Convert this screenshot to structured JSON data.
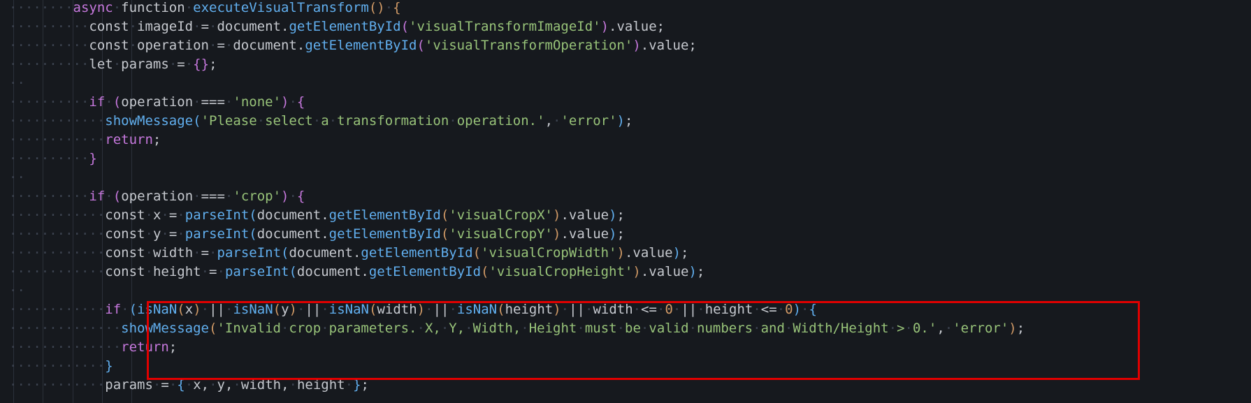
{
  "editor": {
    "theme_colors": {
      "background": "#16191e",
      "keyword": "#c678dd",
      "function": "#61afef",
      "string": "#98c379",
      "number": "#d19a66",
      "text": "#c6c9cf",
      "whitespace_marker": "#3c4350",
      "highlight_border": "#e00000"
    },
    "lines": [
      {
        "indent": 6,
        "tokens": [
          [
            "kw",
            "async"
          ],
          [
            "ws",
            "·"
          ],
          [
            "txt",
            "function"
          ],
          [
            "ws",
            "·"
          ],
          [
            "fn",
            "executeVisualTransform"
          ],
          [
            "br1",
            "()"
          ],
          [
            "ws",
            "·"
          ],
          [
            "br1",
            "{"
          ]
        ]
      },
      {
        "indent": 8,
        "tokens": [
          [
            "txt",
            "const"
          ],
          [
            "ws",
            "·"
          ],
          [
            "txt",
            "imageId"
          ],
          [
            "ws",
            "·"
          ],
          [
            "txt",
            "="
          ],
          [
            "ws",
            "·"
          ],
          [
            "txt",
            "document."
          ],
          [
            "fn",
            "getElementById"
          ],
          [
            "br2",
            "("
          ],
          [
            "str",
            "'visualTransformImageId'"
          ],
          [
            "br2",
            ")"
          ],
          [
            "txt",
            ".value;"
          ]
        ]
      },
      {
        "indent": 8,
        "tokens": [
          [
            "txt",
            "const"
          ],
          [
            "ws",
            "·"
          ],
          [
            "txt",
            "operation"
          ],
          [
            "ws",
            "·"
          ],
          [
            "txt",
            "="
          ],
          [
            "ws",
            "·"
          ],
          [
            "txt",
            "document."
          ],
          [
            "fn",
            "getElementById"
          ],
          [
            "br2",
            "("
          ],
          [
            "str",
            "'visualTransformOperation'"
          ],
          [
            "br2",
            ")"
          ],
          [
            "txt",
            ".value;"
          ]
        ]
      },
      {
        "indent": 8,
        "tokens": [
          [
            "txt",
            "let"
          ],
          [
            "ws",
            "·"
          ],
          [
            "txt",
            "params"
          ],
          [
            "ws",
            "·"
          ],
          [
            "txt",
            "="
          ],
          [
            "ws",
            "·"
          ],
          [
            "br2",
            "{}"
          ],
          [
            "txt",
            ";"
          ]
        ]
      },
      {
        "indent": 0,
        "tokens": []
      },
      {
        "indent": 8,
        "tokens": [
          [
            "kw",
            "if"
          ],
          [
            "ws",
            "·"
          ],
          [
            "br2",
            "("
          ],
          [
            "txt",
            "operation"
          ],
          [
            "ws",
            "·"
          ],
          [
            "txt",
            "==="
          ],
          [
            "ws",
            "·"
          ],
          [
            "str",
            "'none'"
          ],
          [
            "br2",
            ")"
          ],
          [
            "ws",
            "·"
          ],
          [
            "br2",
            "{"
          ]
        ]
      },
      {
        "indent": 10,
        "tokens": [
          [
            "fn",
            "showMessage"
          ],
          [
            "br3",
            "("
          ],
          [
            "str",
            "'Please"
          ],
          [
            "ws",
            "·"
          ],
          [
            "str",
            "select"
          ],
          [
            "ws",
            "·"
          ],
          [
            "str",
            "a"
          ],
          [
            "ws",
            "·"
          ],
          [
            "str",
            "transformation"
          ],
          [
            "ws",
            "·"
          ],
          [
            "str",
            "operation.'"
          ],
          [
            "txt",
            ","
          ],
          [
            "ws",
            "·"
          ],
          [
            "str",
            "'error'"
          ],
          [
            "br3",
            ")"
          ],
          [
            "txt",
            ";"
          ]
        ]
      },
      {
        "indent": 10,
        "tokens": [
          [
            "kw",
            "return"
          ],
          [
            "txt",
            ";"
          ]
        ]
      },
      {
        "indent": 8,
        "tokens": [
          [
            "br2",
            "}"
          ]
        ]
      },
      {
        "indent": 0,
        "tokens": []
      },
      {
        "indent": 8,
        "tokens": [
          [
            "kw",
            "if"
          ],
          [
            "ws",
            "·"
          ],
          [
            "br2",
            "("
          ],
          [
            "txt",
            "operation"
          ],
          [
            "ws",
            "·"
          ],
          [
            "txt",
            "==="
          ],
          [
            "ws",
            "·"
          ],
          [
            "str",
            "'crop'"
          ],
          [
            "br2",
            ")"
          ],
          [
            "ws",
            "·"
          ],
          [
            "br2",
            "{"
          ]
        ]
      },
      {
        "indent": 10,
        "tokens": [
          [
            "txt",
            "const"
          ],
          [
            "ws",
            "·"
          ],
          [
            "txt",
            "x"
          ],
          [
            "ws",
            "·"
          ],
          [
            "txt",
            "="
          ],
          [
            "ws",
            "·"
          ],
          [
            "fn",
            "parseInt"
          ],
          [
            "br3",
            "("
          ],
          [
            "txt",
            "document."
          ],
          [
            "fn",
            "getElementById"
          ],
          [
            "br1",
            "("
          ],
          [
            "str",
            "'visualCropX'"
          ],
          [
            "br1",
            ")"
          ],
          [
            "txt",
            ".value"
          ],
          [
            "br3",
            ")"
          ],
          [
            "txt",
            ";"
          ]
        ]
      },
      {
        "indent": 10,
        "tokens": [
          [
            "txt",
            "const"
          ],
          [
            "ws",
            "·"
          ],
          [
            "txt",
            "y"
          ],
          [
            "ws",
            "·"
          ],
          [
            "txt",
            "="
          ],
          [
            "ws",
            "·"
          ],
          [
            "fn",
            "parseInt"
          ],
          [
            "br3",
            "("
          ],
          [
            "txt",
            "document."
          ],
          [
            "fn",
            "getElementById"
          ],
          [
            "br1",
            "("
          ],
          [
            "str",
            "'visualCropY'"
          ],
          [
            "br1",
            ")"
          ],
          [
            "txt",
            ".value"
          ],
          [
            "br3",
            ")"
          ],
          [
            "txt",
            ";"
          ]
        ]
      },
      {
        "indent": 10,
        "tokens": [
          [
            "txt",
            "const"
          ],
          [
            "ws",
            "·"
          ],
          [
            "txt",
            "width"
          ],
          [
            "ws",
            "·"
          ],
          [
            "txt",
            "="
          ],
          [
            "ws",
            "·"
          ],
          [
            "fn",
            "parseInt"
          ],
          [
            "br3",
            "("
          ],
          [
            "txt",
            "document."
          ],
          [
            "fn",
            "getElementById"
          ],
          [
            "br1",
            "("
          ],
          [
            "str",
            "'visualCropWidth'"
          ],
          [
            "br1",
            ")"
          ],
          [
            "txt",
            ".value"
          ],
          [
            "br3",
            ")"
          ],
          [
            "txt",
            ";"
          ]
        ]
      },
      {
        "indent": 10,
        "tokens": [
          [
            "txt",
            "const"
          ],
          [
            "ws",
            "·"
          ],
          [
            "txt",
            "height"
          ],
          [
            "ws",
            "·"
          ],
          [
            "txt",
            "="
          ],
          [
            "ws",
            "·"
          ],
          [
            "fn",
            "parseInt"
          ],
          [
            "br3",
            "("
          ],
          [
            "txt",
            "document."
          ],
          [
            "fn",
            "getElementById"
          ],
          [
            "br1",
            "("
          ],
          [
            "str",
            "'visualCropHeight'"
          ],
          [
            "br1",
            ")"
          ],
          [
            "txt",
            ".value"
          ],
          [
            "br3",
            ")"
          ],
          [
            "txt",
            ";"
          ]
        ]
      },
      {
        "indent": 0,
        "tokens": []
      },
      {
        "indent": 10,
        "tokens": [
          [
            "kw",
            "if"
          ],
          [
            "ws",
            "·"
          ],
          [
            "br3",
            "("
          ],
          [
            "fn",
            "isNaN"
          ],
          [
            "br1",
            "("
          ],
          [
            "txt",
            "x"
          ],
          [
            "br1",
            ")"
          ],
          [
            "ws",
            "·"
          ],
          [
            "txt",
            "||"
          ],
          [
            "ws",
            "·"
          ],
          [
            "fn",
            "isNaN"
          ],
          [
            "br1",
            "("
          ],
          [
            "txt",
            "y"
          ],
          [
            "br1",
            ")"
          ],
          [
            "ws",
            "·"
          ],
          [
            "txt",
            "||"
          ],
          [
            "ws",
            "·"
          ],
          [
            "fn",
            "isNaN"
          ],
          [
            "br1",
            "("
          ],
          [
            "txt",
            "width"
          ],
          [
            "br1",
            ")"
          ],
          [
            "ws",
            "·"
          ],
          [
            "txt",
            "||"
          ],
          [
            "ws",
            "·"
          ],
          [
            "fn",
            "isNaN"
          ],
          [
            "br1",
            "("
          ],
          [
            "txt",
            "height"
          ],
          [
            "br1",
            ")"
          ],
          [
            "ws",
            "·"
          ],
          [
            "txt",
            "||"
          ],
          [
            "ws",
            "·"
          ],
          [
            "txt",
            "width"
          ],
          [
            "ws",
            "·"
          ],
          [
            "txt",
            "<="
          ],
          [
            "ws",
            "·"
          ],
          [
            "num",
            "0"
          ],
          [
            "ws",
            "·"
          ],
          [
            "txt",
            "||"
          ],
          [
            "ws",
            "·"
          ],
          [
            "txt",
            "height"
          ],
          [
            "ws",
            "·"
          ],
          [
            "txt",
            "<="
          ],
          [
            "ws",
            "·"
          ],
          [
            "num",
            "0"
          ],
          [
            "br3",
            ")"
          ],
          [
            "ws",
            "·"
          ],
          [
            "br3",
            "{"
          ]
        ]
      },
      {
        "indent": 12,
        "tokens": [
          [
            "fn",
            "showMessage"
          ],
          [
            "br1",
            "("
          ],
          [
            "str",
            "'Invalid"
          ],
          [
            "ws",
            "·"
          ],
          [
            "str",
            "crop"
          ],
          [
            "ws",
            "·"
          ],
          [
            "str",
            "parameters."
          ],
          [
            "ws",
            "·"
          ],
          [
            "str",
            "X,"
          ],
          [
            "ws",
            "·"
          ],
          [
            "str",
            "Y,"
          ],
          [
            "ws",
            "·"
          ],
          [
            "str",
            "Width,"
          ],
          [
            "ws",
            "·"
          ],
          [
            "str",
            "Height"
          ],
          [
            "ws",
            "·"
          ],
          [
            "str",
            "must"
          ],
          [
            "ws",
            "·"
          ],
          [
            "str",
            "be"
          ],
          [
            "ws",
            "·"
          ],
          [
            "str",
            "valid"
          ],
          [
            "ws",
            "·"
          ],
          [
            "str",
            "numbers"
          ],
          [
            "ws",
            "·"
          ],
          [
            "str",
            "and"
          ],
          [
            "ws",
            "·"
          ],
          [
            "str",
            "Width/Height"
          ],
          [
            "ws",
            "·"
          ],
          [
            "str",
            ">"
          ],
          [
            "ws",
            "·"
          ],
          [
            "str",
            "0.'"
          ],
          [
            "txt",
            ","
          ],
          [
            "ws",
            "·"
          ],
          [
            "str",
            "'error'"
          ],
          [
            "br1",
            ")"
          ],
          [
            "txt",
            ";"
          ]
        ]
      },
      {
        "indent": 12,
        "tokens": [
          [
            "kw",
            "return"
          ],
          [
            "txt",
            ";"
          ]
        ]
      },
      {
        "indent": 10,
        "tokens": [
          [
            "br3",
            "}"
          ]
        ]
      },
      {
        "indent": 10,
        "tokens": [
          [
            "txt",
            "params"
          ],
          [
            "ws",
            "·"
          ],
          [
            "txt",
            "="
          ],
          [
            "ws",
            "·"
          ],
          [
            "br3",
            "{"
          ],
          [
            "ws",
            "·"
          ],
          [
            "txt",
            "x,"
          ],
          [
            "ws",
            "·"
          ],
          [
            "txt",
            "y,"
          ],
          [
            "ws",
            "·"
          ],
          [
            "txt",
            "width,"
          ],
          [
            "ws",
            "·"
          ],
          [
            "txt",
            "height"
          ],
          [
            "ws",
            "·"
          ],
          [
            "br3",
            "}"
          ],
          [
            "txt",
            ";"
          ]
        ]
      }
    ]
  }
}
